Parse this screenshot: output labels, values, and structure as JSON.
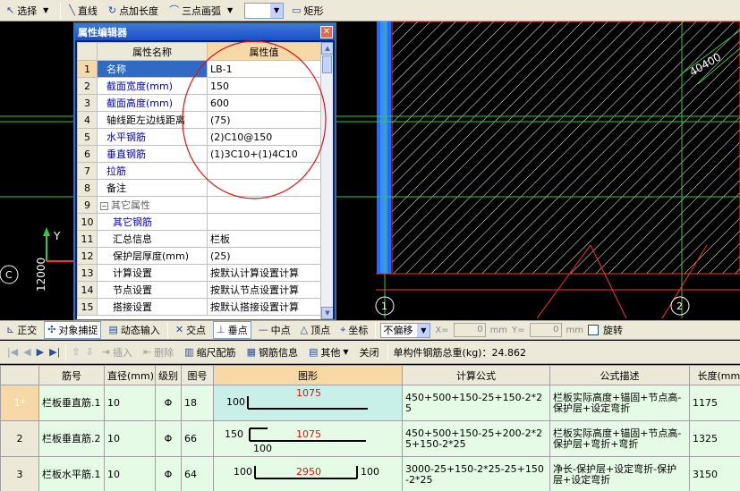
{
  "toolbar": {
    "select_label": "选择",
    "line_label": "直线",
    "point_length_label": "点加长度",
    "arc_label": "三点画弧",
    "rect_label": "矩形"
  },
  "cad": {
    "axis_y_label": "Y",
    "axis_label_c": "C",
    "dim_label": "12000",
    "axis_label_1": "1",
    "axis_label_2": "2",
    "dim_label_diag": "40400"
  },
  "property_editor": {
    "title": "属性编辑器",
    "col_name": "属性名称",
    "col_value": "属性值",
    "rows": [
      {
        "num": "1",
        "name": "名称",
        "value": "LB-1"
      },
      {
        "num": "2",
        "name": "截面宽度(mm)",
        "value": "150"
      },
      {
        "num": "3",
        "name": "截面高度(mm)",
        "value": "600"
      },
      {
        "num": "4",
        "name": "轴线距左边线距离",
        "value": "(75)"
      },
      {
        "num": "5",
        "name": "水平钢筋",
        "value": "(2)C10@150"
      },
      {
        "num": "6",
        "name": "垂直钢筋",
        "value": "(1)3C10+(1)4C10"
      },
      {
        "num": "7",
        "name": "拉筋",
        "value": ""
      },
      {
        "num": "8",
        "name": "备注",
        "value": ""
      },
      {
        "num": "9",
        "name": "其它属性",
        "value": ""
      },
      {
        "num": "10",
        "name": "其它钢筋",
        "value": ""
      },
      {
        "num": "11",
        "name": "汇总信息",
        "value": "栏板"
      },
      {
        "num": "12",
        "name": "保护层厚度(mm)",
        "value": "(25)"
      },
      {
        "num": "13",
        "name": "计算设置",
        "value": "按默认计算设置计算"
      },
      {
        "num": "14",
        "name": "节点设置",
        "value": "按默认节点设置计算"
      },
      {
        "num": "15",
        "name": "搭接设置",
        "value": "按默认搭接设置计算"
      }
    ]
  },
  "snap_toolbar": {
    "ortho_label": "正交",
    "object_snap_label": "对象捕捉",
    "dynamic_input_label": "动态输入",
    "intersection_label": "交点",
    "perpendicular_label": "垂点",
    "midpoint_label": "中点",
    "vertex_label": "顶点",
    "coordinate_label": "坐标",
    "offset_value": "不偏移",
    "x_label": "X=",
    "x_value": "0",
    "y_label": "Y=",
    "y_value": "0",
    "mm_label": "mm",
    "rotate_label": "旋转"
  },
  "rebar_toolbar": {
    "insert_label": "插入",
    "delete_label": "删除",
    "scale_label": "缩尺配筋",
    "info_label": "钢筋信息",
    "other_label": "其他",
    "close_label": "关闭",
    "total_weight_label": "单构件钢筋总重(kg)：24.862"
  },
  "rebar_table": {
    "headers": [
      "筋号",
      "直径(mm)",
      "级别",
      "图号",
      "图形",
      "计算公式",
      "公式描述",
      "长度(mm)"
    ],
    "rows": [
      {
        "rn": "1*",
        "name": "栏板垂直筋.1",
        "dia": "10",
        "grade": "Φ",
        "fig": "18",
        "shape_left": "100",
        "shape_mid": "1075",
        "shape_bottom": "",
        "shape_right": "",
        "formula": "450+500+150-25+150-2*25",
        "desc": "栏板实际高度+锚固+节点高-保护层+设定弯折",
        "length": "1175"
      },
      {
        "rn": "2",
        "name": "栏板垂直筋.2",
        "dia": "10",
        "grade": "Φ",
        "fig": "66",
        "shape_left": "150",
        "shape_mid": "1075",
        "shape_bottom": "100",
        "shape_right": "",
        "formula": "450+500+150-25+200-2*25+150-2*25",
        "desc": "栏板实际高度+锚固+节点高-保护层+弯折+弯折",
        "length": "1325"
      },
      {
        "rn": "3",
        "name": "栏板水平筋.1",
        "dia": "10",
        "grade": "Φ",
        "fig": "64",
        "shape_left": "100",
        "shape_mid": "2950",
        "shape_bottom": "",
        "shape_right": "100",
        "formula": "3000-25+150-2*25-25+150-2*25",
        "desc": "净长-保护层+设定弯折-保护层+设定弯折",
        "length": "3150"
      }
    ]
  },
  "colors": {
    "cad_bg": "#000000",
    "hatch": "#ffffff",
    "annotation": "#e01010",
    "grid_row": "#e6fbe6"
  }
}
